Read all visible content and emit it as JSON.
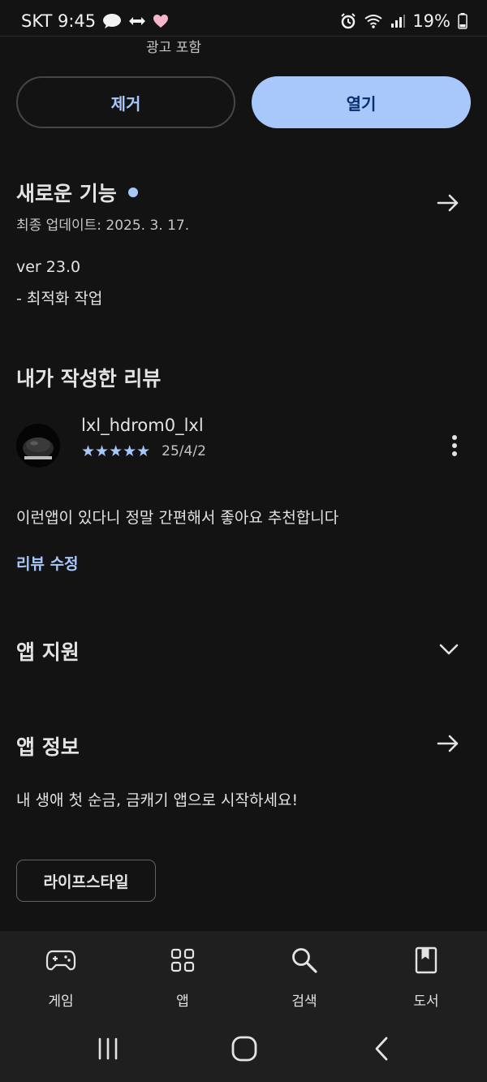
{
  "status_bar": {
    "carrier_time": "SKT 9:45",
    "battery": "19%"
  },
  "header": {
    "ads_label": "광고 포함"
  },
  "actions": {
    "remove_label": "제거",
    "open_label": "열기"
  },
  "whats_new": {
    "title": "새로운 기능",
    "updated": "최종 업데이트: 2025. 3. 17.",
    "version": "ver 23.0",
    "notes": "- 최적화 작업"
  },
  "my_review": {
    "title": "내가 작성한 리뷰",
    "username": "lxl_hdrom0_lxl",
    "rating": 5,
    "stars": "★★★★★",
    "date": "25/4/2",
    "text": "이런앱이 있다니 정말 간편해서 좋아요 추천합니다",
    "edit_label": "리뷰 수정"
  },
  "app_support": {
    "title": "앱 지원"
  },
  "app_info": {
    "title": "앱 정보",
    "description": "내 생애 첫 순금, 금캐기 앱으로 시작하세요!",
    "category_chip": "라이프스타일"
  },
  "bottom_nav": {
    "items": [
      {
        "label": "게임",
        "icon": "gamepad-icon"
      },
      {
        "label": "앱",
        "icon": "apps-grid-icon"
      },
      {
        "label": "검색",
        "icon": "search-icon"
      },
      {
        "label": "도서",
        "icon": "book-icon"
      }
    ]
  },
  "colors": {
    "background": "#131314",
    "accent": "#a8c7fa",
    "open_button_text": "#062e6f",
    "nav_background": "#1f1f20"
  }
}
